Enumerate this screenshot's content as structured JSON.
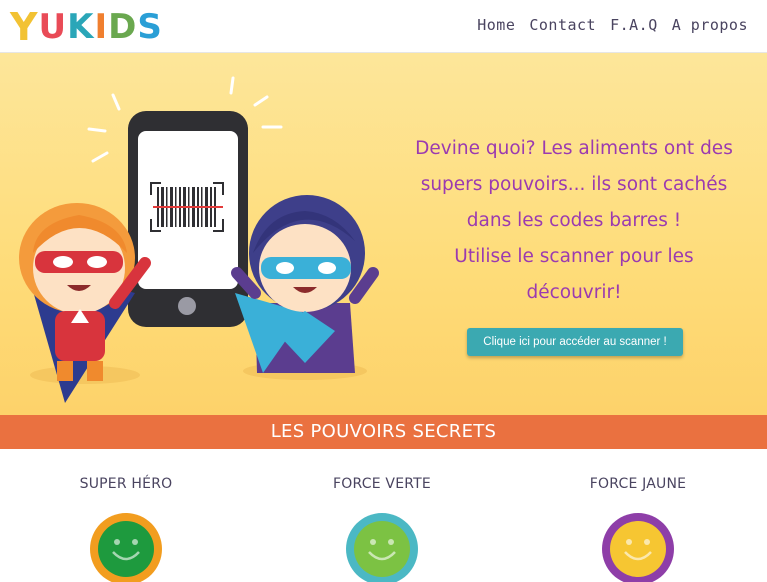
{
  "brand": {
    "letters": [
      "Y",
      "U",
      "K",
      "I",
      "D",
      "S"
    ],
    "letter_colors": [
      "#f2c233",
      "#e94b57",
      "#2aa6b8",
      "#f07f2f",
      "#6aa84f",
      "#2a9fd6"
    ]
  },
  "nav": {
    "items": [
      "Home",
      "Contact",
      "F.A.Q",
      "A propos"
    ]
  },
  "hero": {
    "lines": [
      "Devine quoi? Les aliments ont des",
      "supers pouvoirs... ils sont cachés",
      "dans les codes barres !",
      "Utilise le scanner pour les découvrir!"
    ],
    "cta_label": "Clique ici pour accéder au scanner !"
  },
  "section": {
    "title": "LES POUVOIRS SECRETS"
  },
  "powers": [
    {
      "title": "SUPER HÉRO",
      "badge_color": "#f29d1f",
      "face_color": "#1e9a3e",
      "icon": "happy-face-badge-icon"
    },
    {
      "title": "FORCE VERTE",
      "badge_color": "#4bb8c4",
      "face_color": "#7cc243",
      "icon": "happy-face-badge-icon"
    },
    {
      "title": "FORCE JAUNE",
      "badge_color": "#8e3ea8",
      "face_color": "#f6c632",
      "icon": "happy-face-badge-icon"
    }
  ],
  "colors": {
    "hero_text": "#9b3ab0",
    "band": "#ea7140",
    "button": "#3ba9b1"
  }
}
